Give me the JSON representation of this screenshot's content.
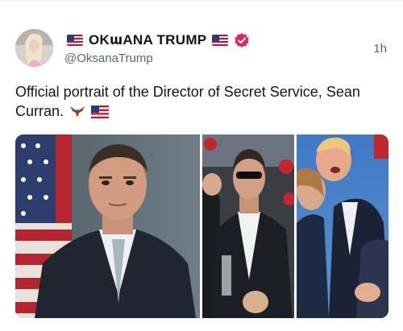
{
  "author": {
    "display_name": "OKաANA TRUMP",
    "handle": "@OksanaTrump",
    "flag_left": "us-flag-icon",
    "flag_right": "us-flag-icon",
    "verified_icon": "verified-badge-icon",
    "verified_color": "#e0245e"
  },
  "post": {
    "time": "1h",
    "text": "Official portrait of the Director of Secret Service, Sean Curran.",
    "emojis": [
      "eagle-icon",
      "us-flag-icon"
    ]
  },
  "media": {
    "photos": [
      {
        "icon": "portrait-photo"
      },
      {
        "icon": "agent-photo"
      },
      {
        "icon": "rally-photo"
      }
    ]
  },
  "colors": {
    "text": "#14171a",
    "muted": "#5b6670",
    "divider": "#e6ecf0"
  }
}
